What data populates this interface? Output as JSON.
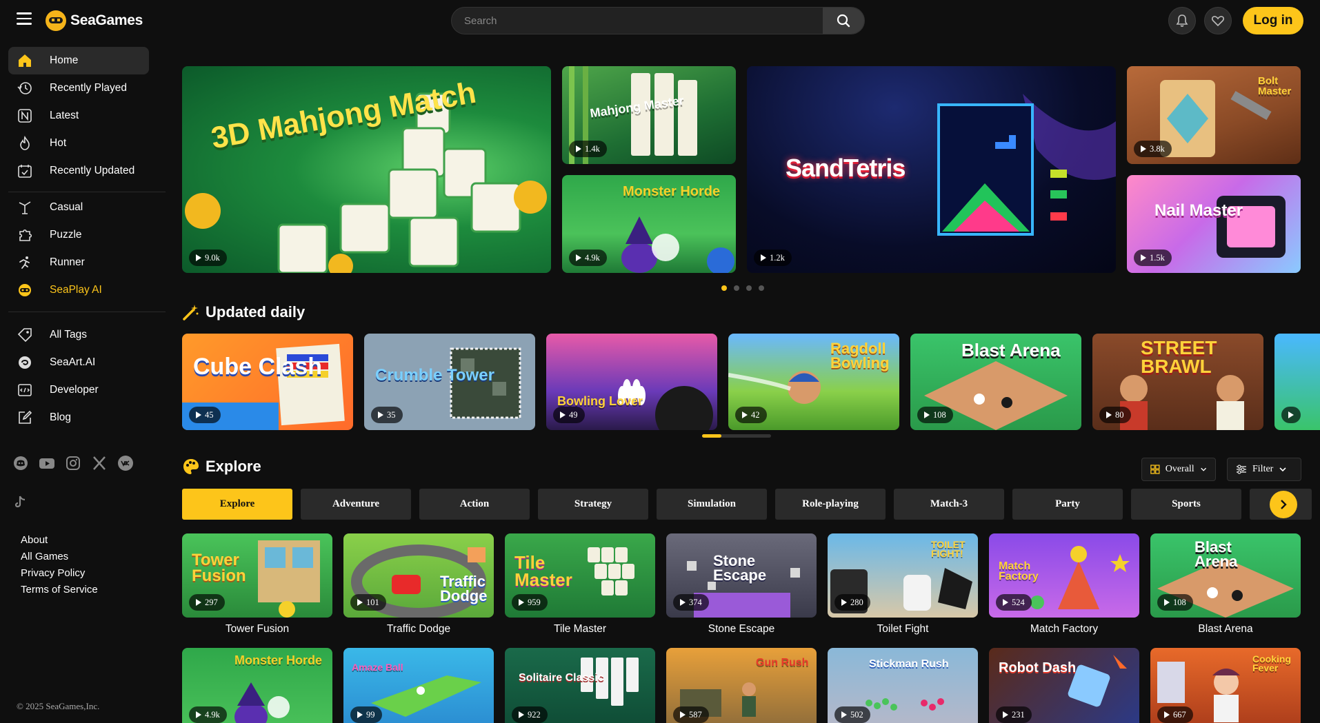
{
  "brand": {
    "name": "SeaGames"
  },
  "search": {
    "placeholder": "Search"
  },
  "header": {
    "login_label": "Log in"
  },
  "sidebar": {
    "items": [
      {
        "label": "Home",
        "icon": "home-icon"
      },
      {
        "label": "Recently Played",
        "icon": "history-icon"
      },
      {
        "label": "Latest",
        "icon": "new-icon"
      },
      {
        "label": "Hot",
        "icon": "fire-icon"
      },
      {
        "label": "Recently Updated",
        "icon": "calendar-icon"
      },
      {
        "label": "Casual",
        "icon": "casual-icon"
      },
      {
        "label": "Puzzle",
        "icon": "puzzle-icon"
      },
      {
        "label": "Runner",
        "icon": "runner-icon"
      },
      {
        "label": "SeaPlay AI",
        "icon": "seaplay-icon"
      },
      {
        "label": "All Tags",
        "icon": "tag-icon"
      },
      {
        "label": "SeaArt.AI",
        "icon": "seaart-icon"
      },
      {
        "label": "Developer",
        "icon": "developer-icon"
      },
      {
        "label": "Blog",
        "icon": "blog-icon"
      }
    ],
    "footer_links": [
      "About",
      "All Games",
      "Privacy Policy",
      "Terms of Service"
    ],
    "copyright": "© 2025 SeaGames,Inc."
  },
  "hero": [
    {
      "title": "3D Mahjong Match",
      "plays": "9.0k"
    },
    {
      "title": "Mahjong Master",
      "plays": "1.4k"
    },
    {
      "title": "Monster Horde",
      "plays": "4.9k"
    },
    {
      "title": "SandTetris",
      "plays": "1.2k"
    },
    {
      "title": "Bolt Master",
      "plays": "3.8k"
    },
    {
      "title": "Nail Master",
      "plays": "1.5k"
    }
  ],
  "updated_daily": {
    "title": "Updated daily",
    "cards": [
      {
        "title": "Cube Clash",
        "plays": "45"
      },
      {
        "title": "Crumble Tower",
        "plays": "35"
      },
      {
        "title": "Bowling Lover",
        "plays": "49"
      },
      {
        "title": "Ragdoll Bowling",
        "plays": "42"
      },
      {
        "title": "Blast Arena",
        "plays": "108"
      },
      {
        "title": "STREET BRAWL",
        "plays": "80"
      }
    ]
  },
  "explore": {
    "title": "Explore",
    "overall_label": "Overall",
    "filter_label": "Filter",
    "tabs": [
      "Explore",
      "Adventure",
      "Action",
      "Strategy",
      "Simulation",
      "Role-playing",
      "Match-3",
      "Party",
      "Sports"
    ],
    "games": [
      {
        "name": "Tower Fusion",
        "plays": "297"
      },
      {
        "name": "Traffic Dodge",
        "plays": "101"
      },
      {
        "name": "Tile Master",
        "plays": "959"
      },
      {
        "name": "Stone Escape",
        "plays": "374"
      },
      {
        "name": "Toilet Fight",
        "plays": "280"
      },
      {
        "name": "Match Factory",
        "plays": "524"
      },
      {
        "name": "Blast Arena",
        "plays": "108"
      }
    ],
    "games_row2": [
      {
        "title": "Monster Horde",
        "plays": "4.9k"
      },
      {
        "title": "Amaze Ball",
        "plays": "99"
      },
      {
        "title": "Solitaire Classic",
        "plays": "922"
      },
      {
        "title": "Gun Rush",
        "plays": "587"
      },
      {
        "title": "Stickman Rush",
        "plays": "502"
      },
      {
        "title": "Robot Dash",
        "plays": "231"
      },
      {
        "title": "Cooking Fever",
        "plays": "667"
      }
    ]
  },
  "colors": {
    "accent": "#fdc51a",
    "background": "#0f0f0f",
    "panel": "#2a2a2a"
  }
}
